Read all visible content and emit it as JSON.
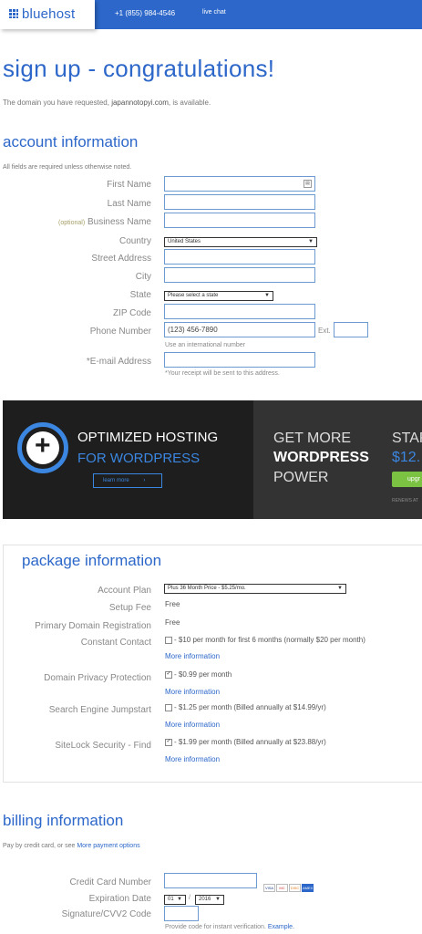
{
  "header": {
    "logo_text": "bluehost",
    "phone": "+1 (855) 984-4546",
    "live_chat": "live chat",
    "brand_color": "#2c67c9"
  },
  "page": {
    "title": "sign up - congratulations!",
    "domain_prefix": "The domain you have requested,",
    "domain": "japannotopyi.com",
    "domain_suffix": ", is available."
  },
  "account": {
    "heading": "account information",
    "note": "All fields are required unless otherwise noted.",
    "first_name": "First Name",
    "last_name": "Last Name",
    "optional": "(optional)",
    "business_name": "Business Name",
    "country": "Country",
    "country_value": "United States",
    "street": "Street Address",
    "city": "City",
    "state": "State",
    "state_value": "Please select a state",
    "zip": "ZIP Code",
    "phone": "Phone Number",
    "phone_value": "(123) 456-7890",
    "ext": "Ext.",
    "intl_hint": "Use an international number",
    "email": "*E-mail Address",
    "email_hint": "*Your receipt will be sent to this address."
  },
  "banner": {
    "line1": "OPTIMIZED HOSTING",
    "line2": "FOR WORDPRESS",
    "learn_more": "learn more",
    "get_more": "GET MORE",
    "wordpress": "WORDPRESS",
    "power": "POWER",
    "start": "STAR",
    "price": "$12.",
    "upgrade": "upgr",
    "renews": "RENEWS AT"
  },
  "package": {
    "heading": "package information",
    "account_plan": "Account Plan",
    "account_plan_value": "Plus 36 Month Price - $5.25/mo.",
    "setup_fee": "Setup Fee",
    "setup_fee_value": "Free",
    "primary_domain": "Primary Domain Registration",
    "primary_domain_value": "Free",
    "constant_contact": "Constant Contact",
    "constant_contact_value": "- $10 per month for first 6 months (normally $20 per month)",
    "domain_privacy": "Domain Privacy Protection",
    "domain_privacy_value": "- $0.99 per month",
    "search_engine": "Search Engine Jumpstart",
    "search_engine_value": "- $1.25 per month (Billed annually at $14.99/yr)",
    "sitelock": "SiteLock Security - Find",
    "sitelock_value": "- $1.99 per month (Billed annually at $23.88/yr)",
    "more_info": "More information"
  },
  "billing": {
    "heading": "billing information",
    "pay_prefix": "Pay by credit card, or see",
    "more_options": "More payment options",
    "card_number": "Credit Card Number",
    "expiration": "Expiration Date",
    "exp_month": "01",
    "exp_sep": "/",
    "exp_year": "2016",
    "cvv": "Signature/CVV2 Code",
    "cvv_hint": "Provide code for instant verification.",
    "example": "Example.",
    "card_visa": "VISA",
    "card_mc": "MC",
    "card_disc": "DISC",
    "card_amex": "AMEX"
  }
}
